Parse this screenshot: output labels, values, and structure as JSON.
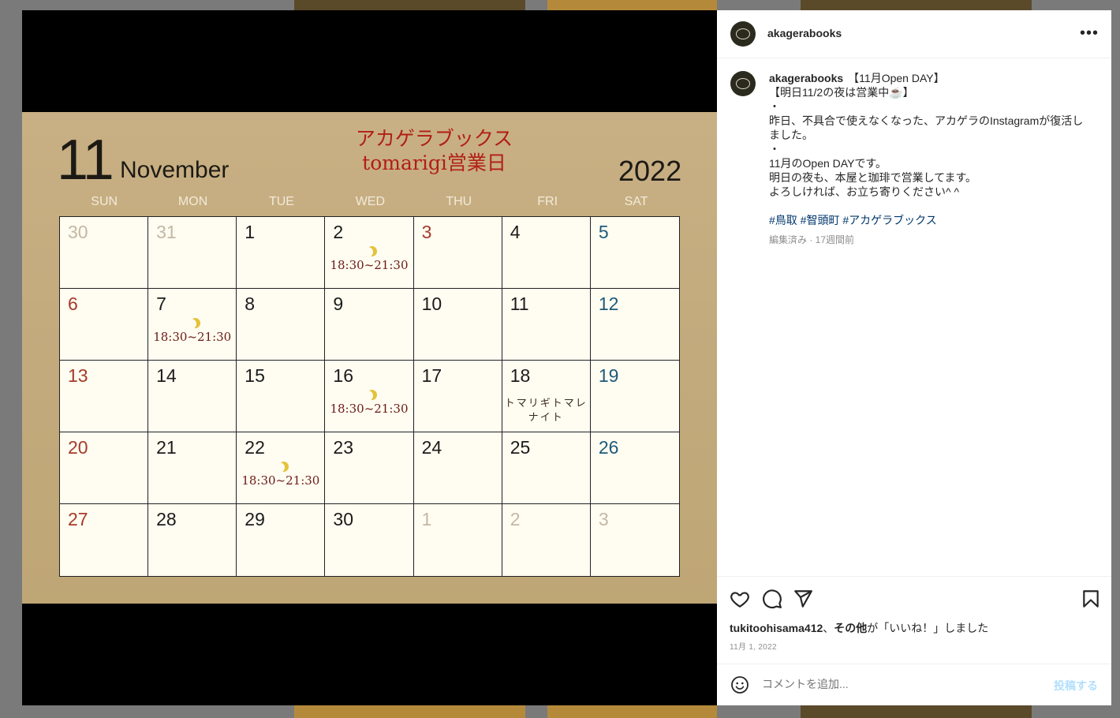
{
  "post": {
    "username": "akagerabooks",
    "caption_title": "【11月Open DAY】",
    "caption_lines": [
      "【明日11/2の夜は営業中☕】",
      "・",
      "昨日、不具合で使えなくなった、アカゲラのInstagramが復活しました。",
      "・",
      "11月のOpen DAYです。",
      "明日の夜も、本屋と珈琲で営業してます。",
      "よろしければ、お立ち寄りください^ ^"
    ],
    "hashtags": "#鳥取 #智頭町 #アカゲラブックス",
    "meta": "編集済み · 17週間前",
    "likes_user": "tukitoohisama412",
    "likes_rest_bold": "その他",
    "likes_rest": "が「いいね！」しました",
    "date": "11月 1, 2022",
    "comment_placeholder": "コメントを追加...",
    "post_button": "投稿する",
    "more_label": "•••"
  },
  "calendar": {
    "month_number": "11",
    "month_name": "November",
    "year": "2022",
    "shop_name": "アカゲラブックス",
    "subtitle": "tomarigi営業日",
    "weekdays": [
      "SUN",
      "MON",
      "TUE",
      "WED",
      "THU",
      "FRI",
      "SAT"
    ],
    "hours_text": "18:30~21:30",
    "event_text_1": "トマリギトマレ",
    "event_text_2": "ナイト",
    "days": [
      "30",
      "31",
      "1",
      "2",
      "3",
      "4",
      "5",
      "6",
      "7",
      "8",
      "9",
      "10",
      "11",
      "12",
      "13",
      "14",
      "15",
      "16",
      "17",
      "18",
      "19",
      "20",
      "21",
      "22",
      "23",
      "24",
      "25",
      "26",
      "27",
      "28",
      "29",
      "30",
      "1",
      "2",
      "3"
    ]
  },
  "colors": {
    "poster_bg": "#c2aa7d",
    "holiday_red": "#b21e16",
    "saturday_blue": "#1d5a7a",
    "hashtag_blue": "#00376b"
  }
}
